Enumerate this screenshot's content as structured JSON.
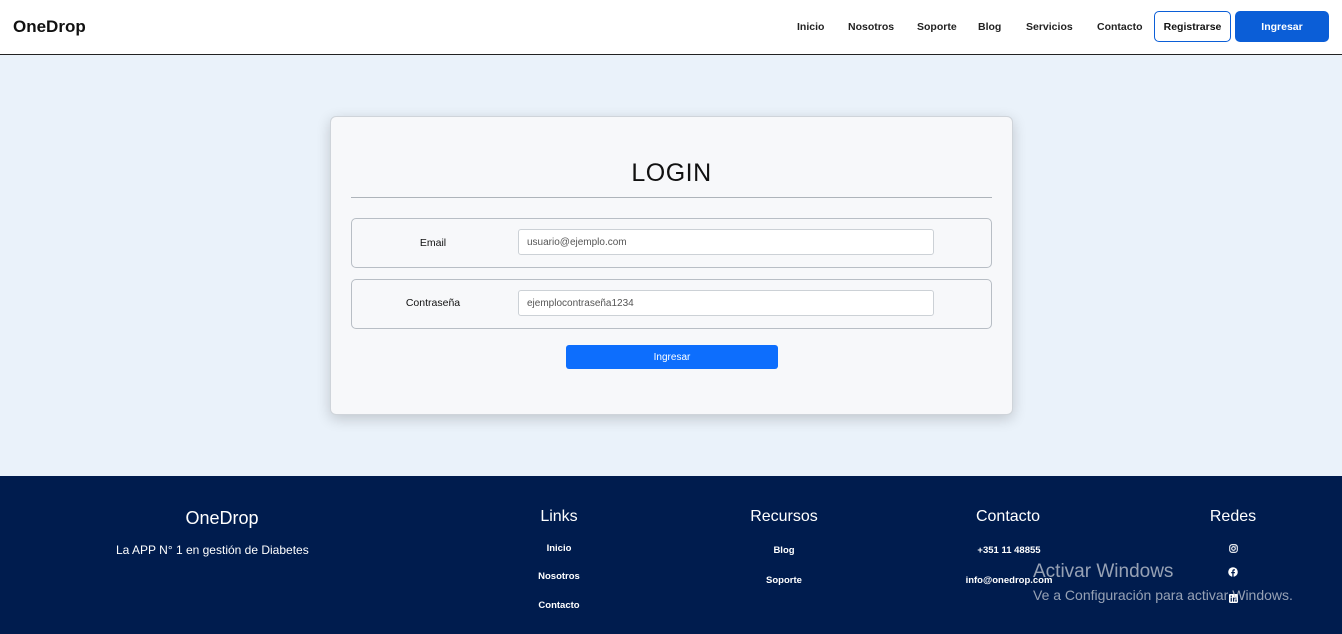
{
  "navbar": {
    "brand": "OneDrop",
    "links": [
      "Inicio",
      "Nosotros",
      "Soporte",
      "Blog",
      "Servicios",
      "Contacto"
    ],
    "register_label": "Registrarse",
    "login_label": "Ingresar",
    "accent_color": "#0b5ed7"
  },
  "login": {
    "title": "LOGIN",
    "email_label": "Email",
    "email_placeholder": "usuario@ejemplo.com",
    "password_label": "Contraseña",
    "password_placeholder": "ejemplocontraseña1234",
    "submit_label": "Ingresar"
  },
  "footer": {
    "brand": "OneDrop",
    "tagline": "La APP N° 1 en gestión de Diabetes",
    "links_heading": "Links",
    "links": [
      "Inicio",
      "Nosotros",
      "Contacto"
    ],
    "resources_heading": "Recursos",
    "resources": [
      "Blog",
      "Soporte"
    ],
    "contact_heading": "Contacto",
    "phone": "+351 11 48855",
    "email": "info@onedrop.com",
    "social_heading": "Redes",
    "social_icons": [
      "instagram-icon",
      "facebook-icon",
      "linkedin-icon"
    ],
    "background_color": "#001c4e"
  },
  "watermark": {
    "title": "Activar Windows",
    "subtitle": "Ve a Configuración para activar Windows."
  }
}
